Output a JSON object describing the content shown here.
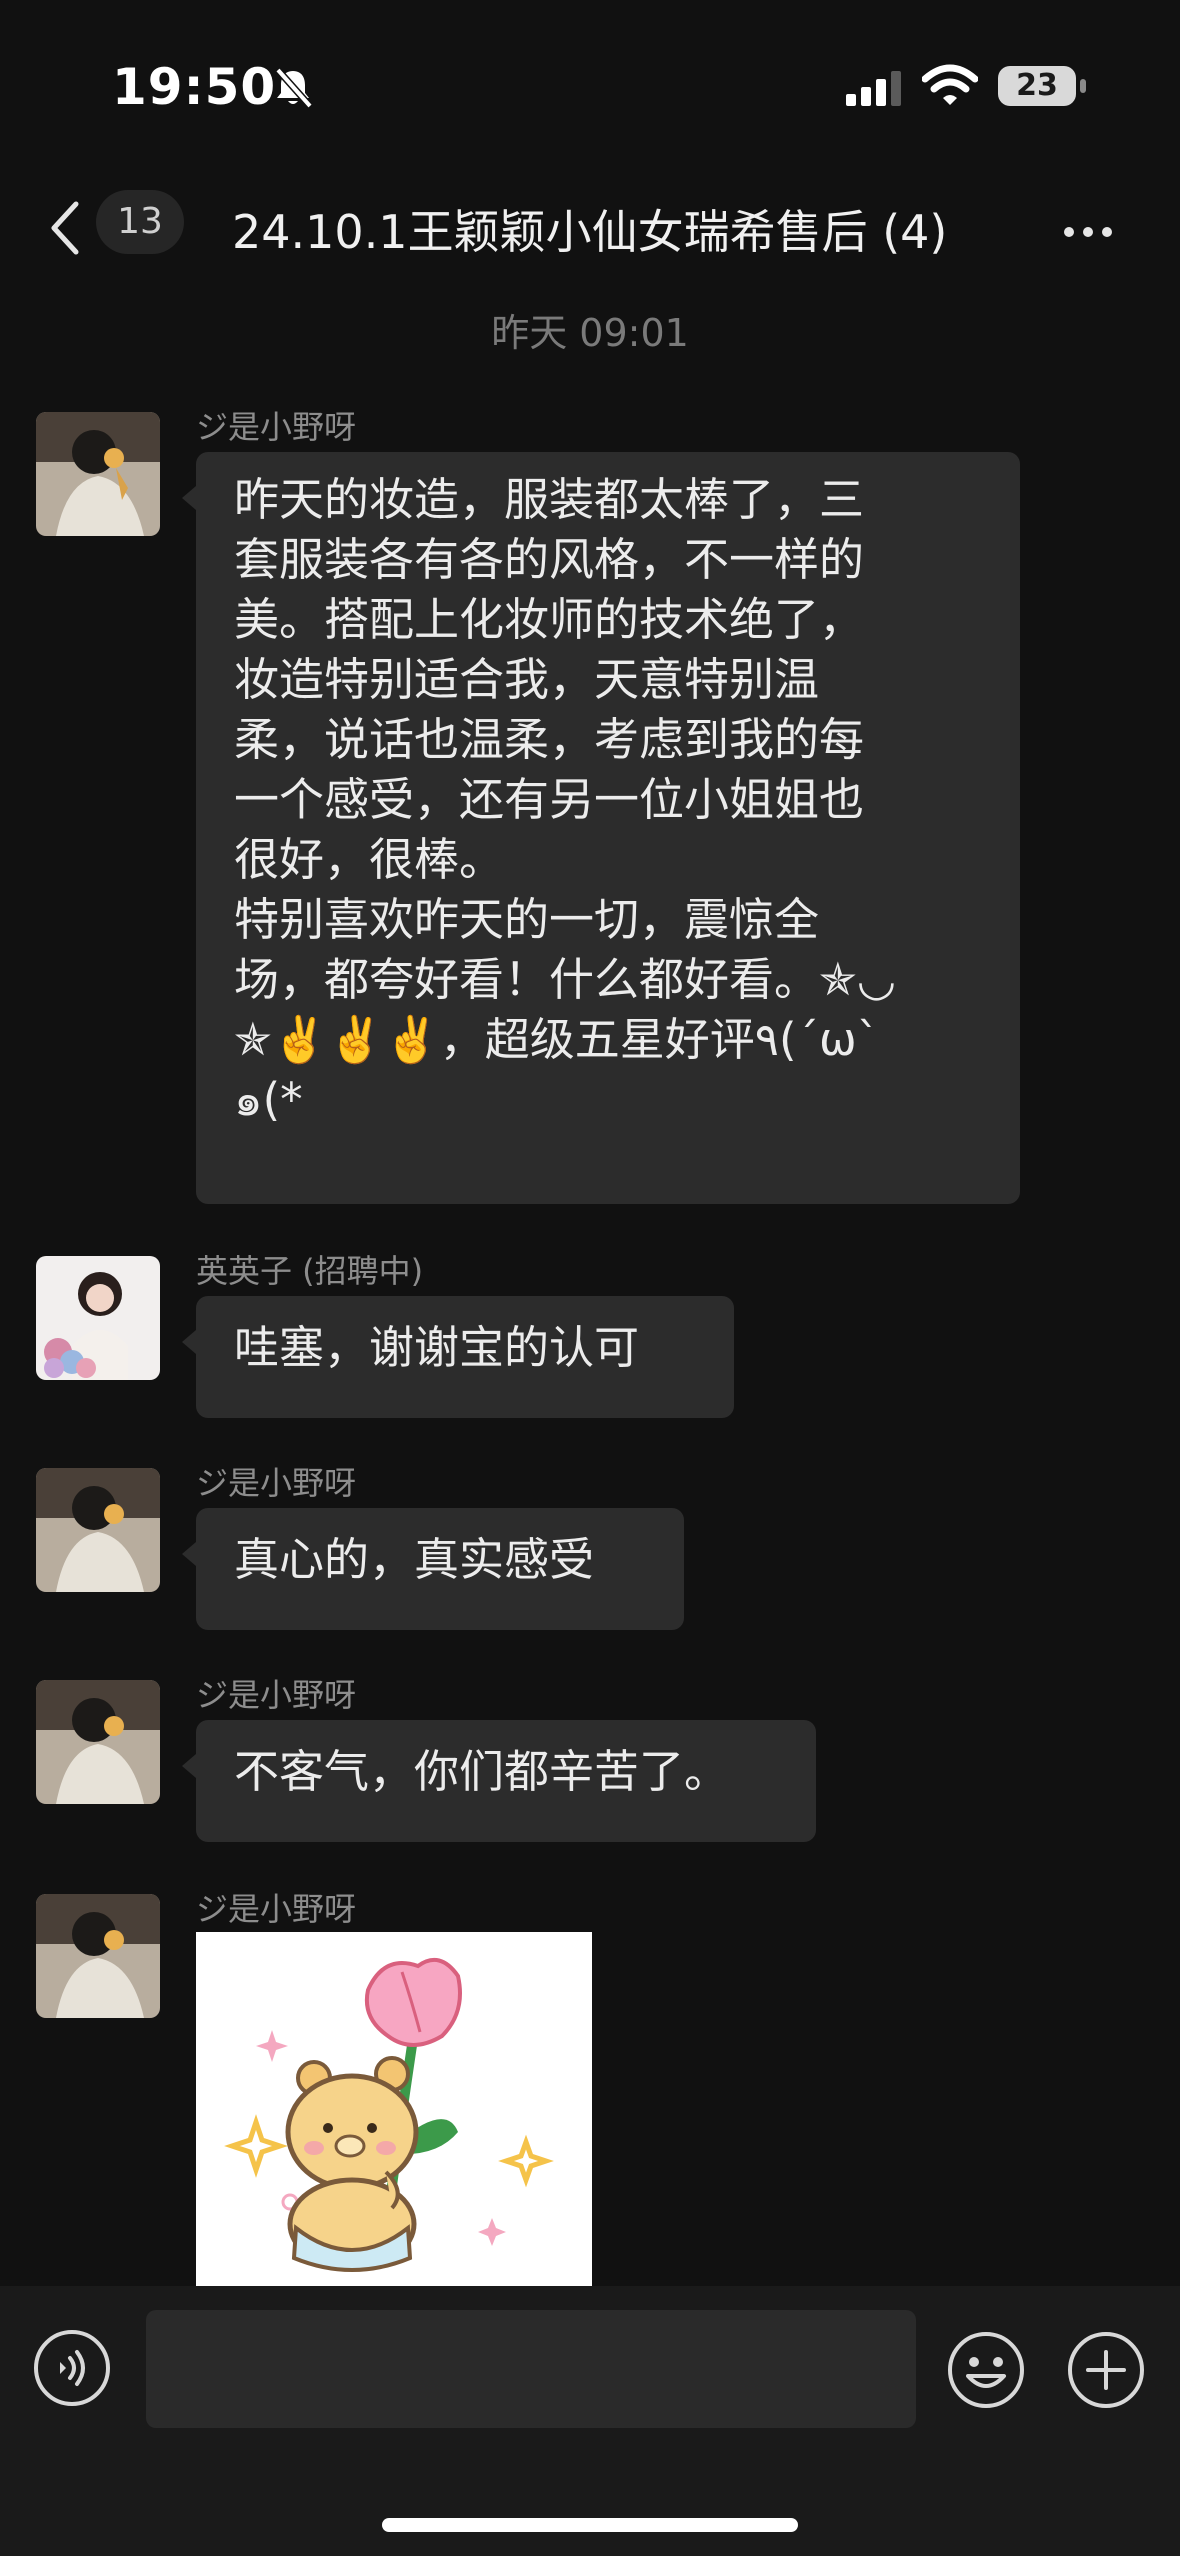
{
  "status_bar": {
    "time": "19:50",
    "battery": "23"
  },
  "header": {
    "unread_count": "13",
    "title": "24.10.1王颖颖小仙女瑞希售后 (4)"
  },
  "timestamp": "昨天 09:01",
  "messages": [
    {
      "sender": "ジ是小野呀",
      "text": "昨天的妆造，服装都太棒了，三\n套服装各有各的风格，不一样的\n美。搭配上化妆师的技术绝了，\n妆造特别适合我，天意特别温\n柔，说话也温柔，考虑到我的每\n一个感受，还有另一位小姐姐也\n很好，很棒。\n特别喜欢昨天的一切，震惊全\n场，都夸好看！什么都好看。✯◡\n✯✌️✌️✌️，超级五星好评٩(ˊωˋ\n๑(*"
    },
    {
      "sender": "英英子 (招聘中)",
      "text": "哇塞，谢谢宝的认可"
    },
    {
      "sender": "ジ是小野呀",
      "text": "真心的，真实感受"
    },
    {
      "sender": "ジ是小野呀",
      "text": "不客气，你们都辛苦了。"
    },
    {
      "sender": "ジ是小野呀",
      "sticker": "bear-with-tulip-sticker"
    }
  ],
  "input": {
    "placeholder": ""
  },
  "icons": {
    "mute": "bell-slash-icon",
    "signal": "cellular-signal-icon",
    "wifi": "wifi-icon",
    "back": "chevron-left-icon",
    "more": "ellipsis-icon",
    "voice": "voice-input-icon",
    "emoji": "emoji-icon",
    "plus": "plus-icon"
  },
  "colors": {
    "background": "#111111",
    "bubble": "#2c2c2c",
    "input_bar": "#1a1a1a",
    "sender_text": "#8d8d8d"
  }
}
